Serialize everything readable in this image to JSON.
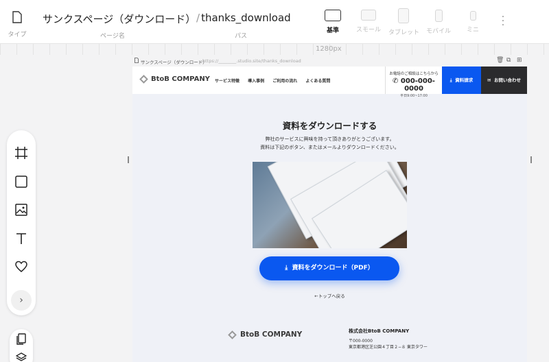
{
  "toolbar": {
    "type_caption": "タイプ",
    "page_name": "サンクスページ（ダウンロード）",
    "page_name_caption": "ページ名",
    "path_value": "thanks_download",
    "path_caption": "パス",
    "devices": [
      {
        "label": "基準",
        "active": true
      },
      {
        "label": "スモール",
        "active": false
      },
      {
        "label": "タブレット",
        "active": false
      },
      {
        "label": "モバイル",
        "active": false
      },
      {
        "label": "ミニ",
        "active": false
      }
    ]
  },
  "ruler": {
    "width_label": "1280px"
  },
  "frame": {
    "title": "サンクスページ（ダウンロード）",
    "url": "https://________.studio.site/thanks_download"
  },
  "site": {
    "logo": "BtoB COMPANY",
    "nav": [
      "サービス特徴",
      "導入事例",
      "ご利用の流れ",
      "よくある質問"
    ],
    "tel_caption": "お電話のご相談はこちらから",
    "tel_number": "000-000-0000",
    "tel_hours": "平日9:00~17:00",
    "btn_download": "資料請求",
    "btn_contact": "お問い合わせ",
    "heading": "資料をダウンロードする",
    "lead_line1": "弊社のサービスに興味を持って頂きありがとうございます。",
    "lead_line2": "資料は下記のボタン、またはメールよりダウンロードください。",
    "cta_label": "資料をダウンロード（PDF）",
    "back_link": "←トップへ戻る",
    "footer": {
      "logo": "BtoB COMPANY",
      "company": "株式会社BtoB COMPANY",
      "zip": "〒000-0000",
      "address": "東京都港区芝公園４丁目２−８ 東京タワー"
    }
  },
  "colors": {
    "accent": "#0a58f0",
    "dark": "#2b2b2d",
    "page_bg": "#eff1f7"
  }
}
